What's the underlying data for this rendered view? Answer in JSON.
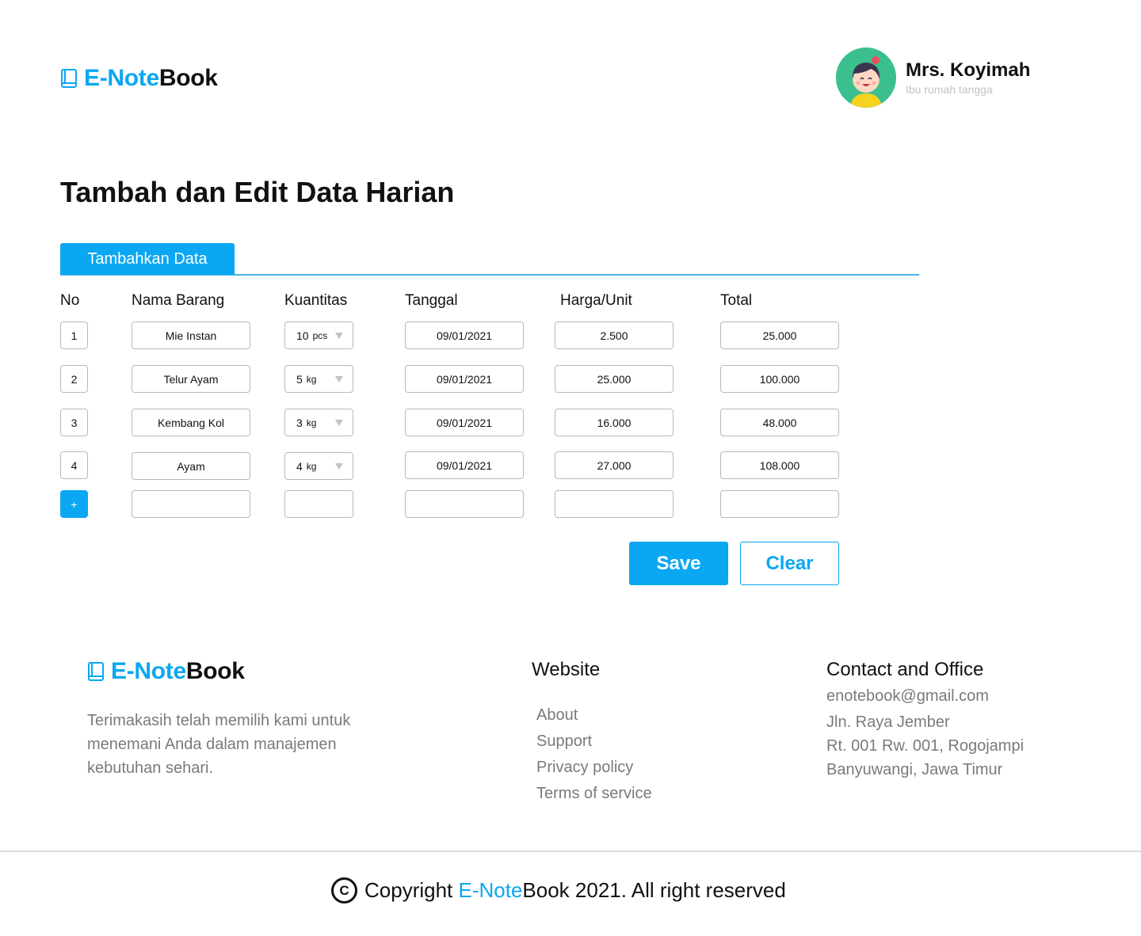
{
  "header": {
    "brand_part1": "E-Note",
    "brand_part2": "Book",
    "user_name": "Mrs. Koyimah",
    "user_role": "Ibu rumah tangga"
  },
  "page_title": "Tambah dan Edit Data Harian",
  "tab_label": "Tambahkan Data",
  "columns": {
    "no": "No",
    "name": "Nama Barang",
    "qty": "Kuantitas",
    "date": "Tanggal",
    "price": "Harga/Unit",
    "total": "Total"
  },
  "rows": [
    {
      "no": "1",
      "name": "Mie Instan",
      "qty": "10",
      "unit": "pcs",
      "date": "09/01/2021",
      "price": "2.500",
      "total": "25.000"
    },
    {
      "no": "2",
      "name": "Telur Ayam",
      "qty": "5",
      "unit": "kg",
      "date": "09/01/2021",
      "price": "25.000",
      "total": "100.000"
    },
    {
      "no": "3",
      "name": "Kembang Kol",
      "qty": "3",
      "unit": "kg",
      "date": "09/01/2021",
      "price": "16.000",
      "total": "48.000"
    },
    {
      "no": "4",
      "name": "Ayam",
      "qty": "4",
      "unit": "kg",
      "date": "09/01/2021",
      "price": "27.000",
      "total": "108.000"
    }
  ],
  "add_row_label": "+",
  "actions": {
    "save": "Save",
    "clear": "Clear"
  },
  "footer": {
    "brand_part1": "E-Note",
    "brand_part2": "Book",
    "description_lines": [
      "Terimakasih telah memilih kami untuk",
      "menemani Anda dalam manajemen",
      "kebutuhan sehari."
    ],
    "website_heading": "Website",
    "links": [
      "About",
      "Support",
      "Privacy policy",
      "Terms of service"
    ],
    "contact_heading": "Contact and Office",
    "contact_lines": [
      "enotebook@gmail.com",
      "Jln. Raya Jember",
      "Rt. 001 Rw. 001, Rogojampi",
      "Banyuwangi, Jawa Timur"
    ]
  },
  "copyright": {
    "symbol": "C",
    "prefix": "Copyright ",
    "brand_part1": "E-Note",
    "suffix": "Book 2021. All right reserved"
  },
  "colors": {
    "accent": "#0aa7f2",
    "muted_text": "#7a7a7a",
    "border": "#b9b9b9"
  },
  "icons": {
    "logo": "book-icon",
    "avatar": "avatar-illustration",
    "dropdown": "caret-down-icon",
    "copyright": "copyright-icon"
  }
}
